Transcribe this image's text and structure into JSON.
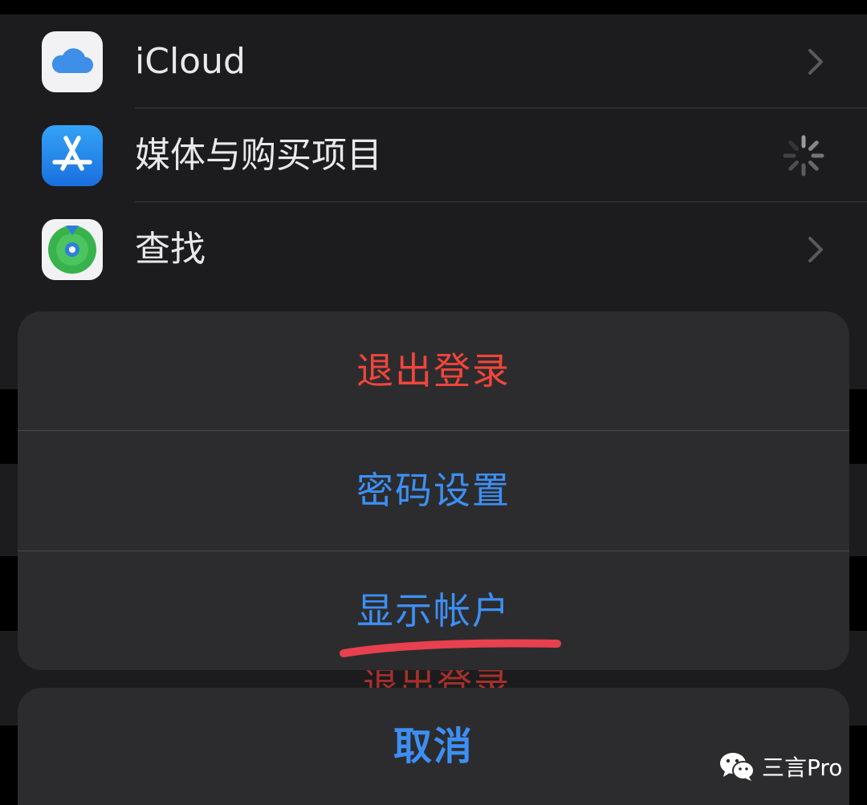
{
  "settings": {
    "items": [
      {
        "label": "iCloud",
        "icon": "icloud-icon",
        "accessory": "chevron"
      },
      {
        "label": "媒体与购买项目",
        "icon": "app-store-icon",
        "accessory": "spinner"
      },
      {
        "label": "查找",
        "icon": "find-my-icon",
        "accessory": "chevron"
      }
    ]
  },
  "action_sheet": {
    "actions": [
      {
        "label": "退出登录",
        "style": "destructive"
      },
      {
        "label": "密码设置",
        "style": "default"
      },
      {
        "label": "显示帐户",
        "style": "default",
        "annotated": true
      }
    ],
    "cancel_label": "取消"
  },
  "background_text": "退出登录",
  "watermark": {
    "icon": "wechat-icon",
    "text": "三言Pro"
  },
  "colors": {
    "background": "#000000",
    "group_background": "#1c1c1e",
    "sheet_background": "#2c2c2e",
    "destructive": "#f1453b",
    "action_blue": "#3d8ff5",
    "annotation_red": "#e8404e"
  }
}
